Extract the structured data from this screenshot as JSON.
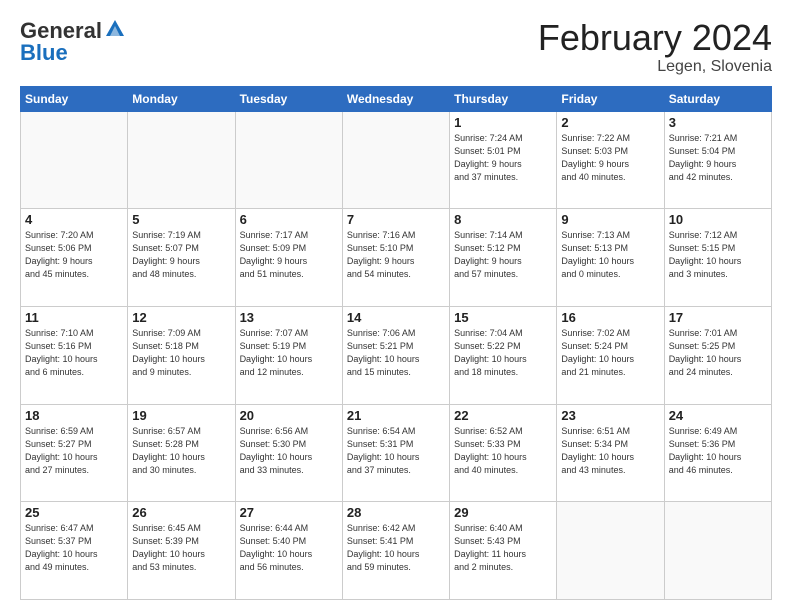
{
  "header": {
    "logo_line1": "General",
    "logo_line2": "Blue",
    "month_title": "February 2024",
    "location": "Legen, Slovenia"
  },
  "calendar": {
    "headers": [
      "Sunday",
      "Monday",
      "Tuesday",
      "Wednesday",
      "Thursday",
      "Friday",
      "Saturday"
    ],
    "weeks": [
      [
        {
          "day": "",
          "info": ""
        },
        {
          "day": "",
          "info": ""
        },
        {
          "day": "",
          "info": ""
        },
        {
          "day": "",
          "info": ""
        },
        {
          "day": "1",
          "info": "Sunrise: 7:24 AM\nSunset: 5:01 PM\nDaylight: 9 hours\nand 37 minutes."
        },
        {
          "day": "2",
          "info": "Sunrise: 7:22 AM\nSunset: 5:03 PM\nDaylight: 9 hours\nand 40 minutes."
        },
        {
          "day": "3",
          "info": "Sunrise: 7:21 AM\nSunset: 5:04 PM\nDaylight: 9 hours\nand 42 minutes."
        }
      ],
      [
        {
          "day": "4",
          "info": "Sunrise: 7:20 AM\nSunset: 5:06 PM\nDaylight: 9 hours\nand 45 minutes."
        },
        {
          "day": "5",
          "info": "Sunrise: 7:19 AM\nSunset: 5:07 PM\nDaylight: 9 hours\nand 48 minutes."
        },
        {
          "day": "6",
          "info": "Sunrise: 7:17 AM\nSunset: 5:09 PM\nDaylight: 9 hours\nand 51 minutes."
        },
        {
          "day": "7",
          "info": "Sunrise: 7:16 AM\nSunset: 5:10 PM\nDaylight: 9 hours\nand 54 minutes."
        },
        {
          "day": "8",
          "info": "Sunrise: 7:14 AM\nSunset: 5:12 PM\nDaylight: 9 hours\nand 57 minutes."
        },
        {
          "day": "9",
          "info": "Sunrise: 7:13 AM\nSunset: 5:13 PM\nDaylight: 10 hours\nand 0 minutes."
        },
        {
          "day": "10",
          "info": "Sunrise: 7:12 AM\nSunset: 5:15 PM\nDaylight: 10 hours\nand 3 minutes."
        }
      ],
      [
        {
          "day": "11",
          "info": "Sunrise: 7:10 AM\nSunset: 5:16 PM\nDaylight: 10 hours\nand 6 minutes."
        },
        {
          "day": "12",
          "info": "Sunrise: 7:09 AM\nSunset: 5:18 PM\nDaylight: 10 hours\nand 9 minutes."
        },
        {
          "day": "13",
          "info": "Sunrise: 7:07 AM\nSunset: 5:19 PM\nDaylight: 10 hours\nand 12 minutes."
        },
        {
          "day": "14",
          "info": "Sunrise: 7:06 AM\nSunset: 5:21 PM\nDaylight: 10 hours\nand 15 minutes."
        },
        {
          "day": "15",
          "info": "Sunrise: 7:04 AM\nSunset: 5:22 PM\nDaylight: 10 hours\nand 18 minutes."
        },
        {
          "day": "16",
          "info": "Sunrise: 7:02 AM\nSunset: 5:24 PM\nDaylight: 10 hours\nand 21 minutes."
        },
        {
          "day": "17",
          "info": "Sunrise: 7:01 AM\nSunset: 5:25 PM\nDaylight: 10 hours\nand 24 minutes."
        }
      ],
      [
        {
          "day": "18",
          "info": "Sunrise: 6:59 AM\nSunset: 5:27 PM\nDaylight: 10 hours\nand 27 minutes."
        },
        {
          "day": "19",
          "info": "Sunrise: 6:57 AM\nSunset: 5:28 PM\nDaylight: 10 hours\nand 30 minutes."
        },
        {
          "day": "20",
          "info": "Sunrise: 6:56 AM\nSunset: 5:30 PM\nDaylight: 10 hours\nand 33 minutes."
        },
        {
          "day": "21",
          "info": "Sunrise: 6:54 AM\nSunset: 5:31 PM\nDaylight: 10 hours\nand 37 minutes."
        },
        {
          "day": "22",
          "info": "Sunrise: 6:52 AM\nSunset: 5:33 PM\nDaylight: 10 hours\nand 40 minutes."
        },
        {
          "day": "23",
          "info": "Sunrise: 6:51 AM\nSunset: 5:34 PM\nDaylight: 10 hours\nand 43 minutes."
        },
        {
          "day": "24",
          "info": "Sunrise: 6:49 AM\nSunset: 5:36 PM\nDaylight: 10 hours\nand 46 minutes."
        }
      ],
      [
        {
          "day": "25",
          "info": "Sunrise: 6:47 AM\nSunset: 5:37 PM\nDaylight: 10 hours\nand 49 minutes."
        },
        {
          "day": "26",
          "info": "Sunrise: 6:45 AM\nSunset: 5:39 PM\nDaylight: 10 hours\nand 53 minutes."
        },
        {
          "day": "27",
          "info": "Sunrise: 6:44 AM\nSunset: 5:40 PM\nDaylight: 10 hours\nand 56 minutes."
        },
        {
          "day": "28",
          "info": "Sunrise: 6:42 AM\nSunset: 5:41 PM\nDaylight: 10 hours\nand 59 minutes."
        },
        {
          "day": "29",
          "info": "Sunrise: 6:40 AM\nSunset: 5:43 PM\nDaylight: 11 hours\nand 2 minutes."
        },
        {
          "day": "",
          "info": ""
        },
        {
          "day": "",
          "info": ""
        }
      ]
    ]
  }
}
